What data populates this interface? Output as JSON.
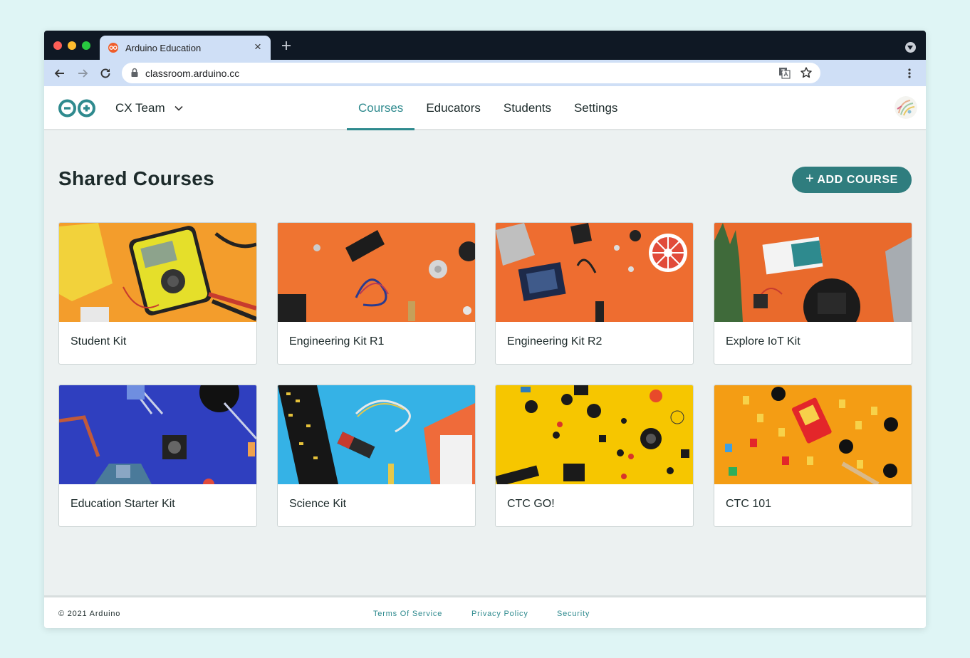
{
  "browser": {
    "tab_title": "Arduino Education",
    "url": "classroom.arduino.cc"
  },
  "header": {
    "team_name": "CX Team",
    "nav": [
      {
        "label": "Courses",
        "active": true
      },
      {
        "label": "Educators",
        "active": false
      },
      {
        "label": "Students",
        "active": false
      },
      {
        "label": "Settings",
        "active": false
      }
    ]
  },
  "main": {
    "title": "Shared Courses",
    "add_button_icon": "+",
    "add_button_label": "ADD COURSE",
    "courses": [
      {
        "title": "Student Kit",
        "bg": "#f39d2c"
      },
      {
        "title": "Engineering Kit R1",
        "bg": "#ef7431"
      },
      {
        "title": "Engineering Kit R2",
        "bg": "#ee6d30"
      },
      {
        "title": "Explore IoT Kit",
        "bg": "#e96a2c"
      },
      {
        "title": "Education Starter Kit",
        "bg": "#2f3fbf"
      },
      {
        "title": "Science Kit",
        "bg": "#35b2e6"
      },
      {
        "title": "CTC GO!",
        "bg": "#f6c600"
      },
      {
        "title": "CTC 101",
        "bg": "#f49d14"
      }
    ]
  },
  "footer": {
    "copyright": "© 2021 Arduino",
    "links": [
      "Terms Of Service",
      "Privacy Policy",
      "Security"
    ]
  },
  "colors": {
    "accent": "#2e8a8e",
    "button": "#2f7d7e",
    "page_bg": "#ecf1f1"
  }
}
